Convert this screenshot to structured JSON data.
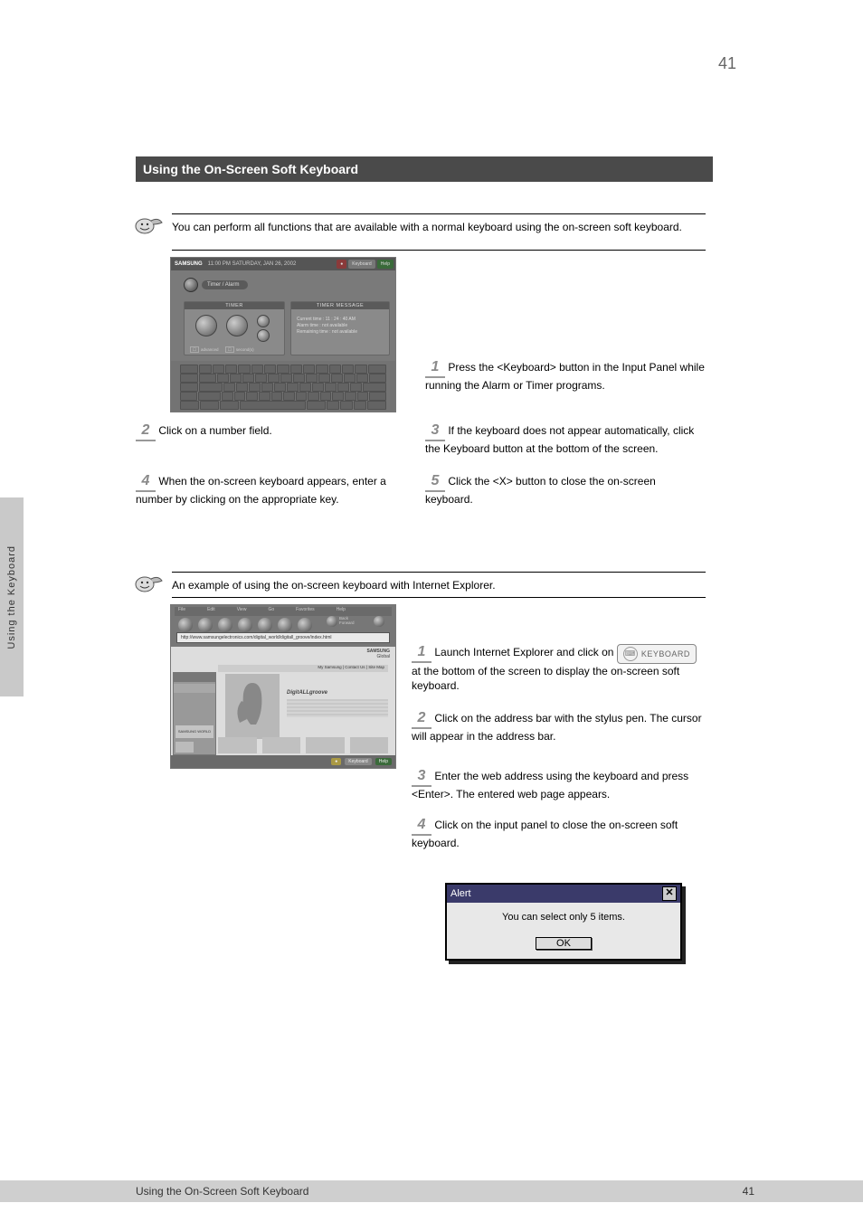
{
  "page_number_top": "41",
  "header_bar": "Using the On-Screen Soft Keyboard",
  "section1": {
    "tip": "You can perform all functions that are available with a normal keyboard using the on-screen soft keyboard.",
    "screenshot": {
      "brand": "SAMSUNG",
      "date": "11:00 PM SATURDAY, JAN 26, 2002",
      "btn_keyboard": "Keyboard",
      "btn_help": "Help",
      "tab": "Timer / Alarm",
      "panel_timer": "TIMER",
      "panel_timer_info": "TIMER MESSAGE",
      "readout_line1": "Current time :  11 : 24 : 40 AM",
      "readout_line2": "Alarm time :    not available",
      "readout_line3": "Remaining time :  not available",
      "chk1": "advanced",
      "chk2": "second(s)"
    },
    "step1": "Press the <Keyboard> button in the Input Panel while running the Alarm or Timer programs.",
    "step2": "Click on a number field.",
    "step3": "If the keyboard does not appear automatically, click the Keyboard button at the bottom of the screen.",
    "step4": "When the on-screen keyboard appears, enter a number by clicking on the appropriate key.",
    "step5": "Click the <X> button to close the on-screen keyboard."
  },
  "section2": {
    "tip": "An example of using the on-screen keyboard with Internet Explorer.",
    "screenshot": {
      "address": "http://www.samsungelectronics.com/digital_world/digitall_groove/index.html",
      "tab_labels": "My Samsung | Contact Us | Site Map",
      "brand": "SAMSUNG",
      "sub": "Global",
      "headline": "DigitALLgroove",
      "badge": "SAMSUNG WORLD",
      "footer_btn1": "Keyboard",
      "footer_btn2": "Help"
    },
    "kb_pill": "KEYBOARD",
    "step1_a": "Launch Internet Explorer and click on",
    "step1_b": " at the bottom of the screen to display the on-screen soft keyboard.",
    "step2": "Click on the address bar with the stylus pen. The cursor will appear in the address bar.",
    "step3": "Enter the web address using the keyboard and press <Enter>. The entered web page appears.",
    "step4": "Click on the input panel to close the on-screen soft keyboard."
  },
  "dialog": {
    "title": "Alert",
    "body": "You can select only 5 items.",
    "ok": "OK"
  },
  "footer": {
    "left": "Using the On-Screen Soft Keyboard",
    "right": "41"
  },
  "left_tab": "Using the Keyboard"
}
